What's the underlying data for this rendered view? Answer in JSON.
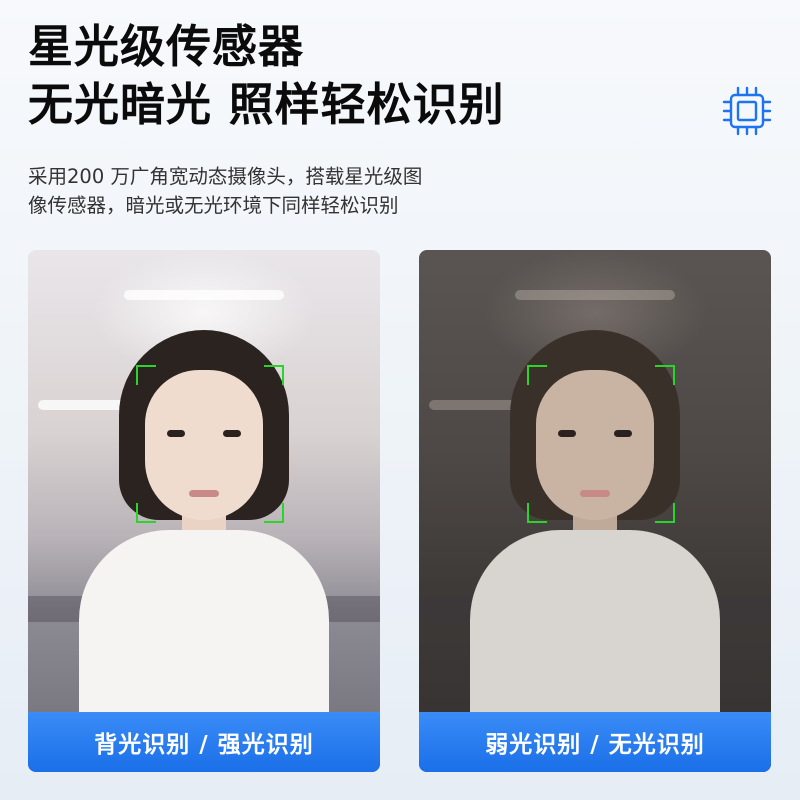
{
  "headline": {
    "line1": "星光级传感器",
    "line2": "无光暗光 照样轻松识别"
  },
  "description": {
    "line1": "采用200 万广角宽动态摄像头，搭载星光级图",
    "line2": "像传感器，暗光或无光环境下同样轻松识别"
  },
  "icons": {
    "sensor": "chip-sensor-icon"
  },
  "panels": [
    {
      "caption": "背光识别 / 强光识别",
      "scene": "bright-backlit-office"
    },
    {
      "caption": "弱光识别 / 无光识别",
      "scene": "dim-low-light-office"
    }
  ],
  "colors": {
    "caption_bar": "#1b6fe8",
    "icon_accent": "#1e73f0",
    "face_frame": "#2bd42b"
  }
}
